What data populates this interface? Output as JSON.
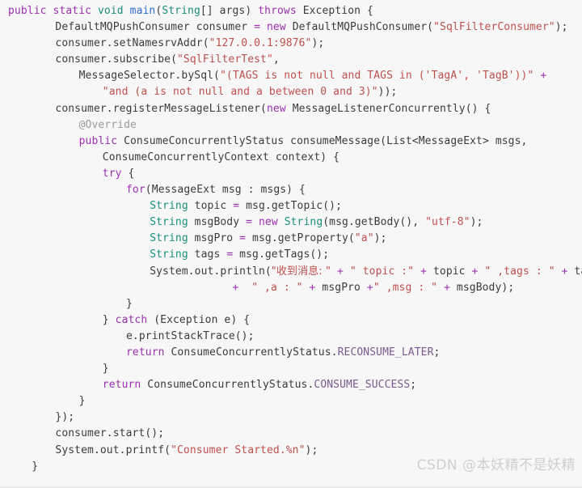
{
  "editor": {
    "background_color": "#f7f7f7",
    "language": "java",
    "font_size_px": 13,
    "line_height_px": 20,
    "colors": {
      "keyword": "#9b30b0",
      "type": "#1a8f7a",
      "function": "#2d6fd8",
      "string": "#c0504d",
      "plain": "#3b3b3b",
      "annotation": "#9a9a9a",
      "constant": "#7a5a8f"
    }
  },
  "watermark": {
    "text": "CSDN @本妖精不是妖精"
  },
  "code": {
    "lines": [
      {
        "indent": 0,
        "tokens": [
          {
            "t": "public",
            "c": "kw"
          },
          {
            "t": " ",
            "c": "plain"
          },
          {
            "t": "static",
            "c": "kw"
          },
          {
            "t": " ",
            "c": "plain"
          },
          {
            "t": "void",
            "c": "type"
          },
          {
            "t": " ",
            "c": "plain"
          },
          {
            "t": "main",
            "c": "fn"
          },
          {
            "t": "(",
            "c": "plain"
          },
          {
            "t": "String",
            "c": "type"
          },
          {
            "t": "[] args) ",
            "c": "plain"
          },
          {
            "t": "throws",
            "c": "kw"
          },
          {
            "t": " Exception {",
            "c": "plain"
          }
        ]
      },
      {
        "indent": 4,
        "tokens": [
          {
            "t": "DefaultMQPushConsumer consumer ",
            "c": "plain"
          },
          {
            "t": "=",
            "c": "op"
          },
          {
            "t": " ",
            "c": "plain"
          },
          {
            "t": "new",
            "c": "kw"
          },
          {
            "t": " DefaultMQPushConsumer(",
            "c": "plain"
          },
          {
            "t": "\"SqlFilterConsumer\"",
            "c": "str"
          },
          {
            "t": ");",
            "c": "plain"
          }
        ]
      },
      {
        "indent": 4,
        "tokens": [
          {
            "t": "consumer.setNamesrvAddr(",
            "c": "plain"
          },
          {
            "t": "\"127.0.0.1:9876\"",
            "c": "str"
          },
          {
            "t": ");",
            "c": "plain"
          }
        ]
      },
      {
        "indent": 4,
        "tokens": [
          {
            "t": "consumer.subscribe(",
            "c": "plain"
          },
          {
            "t": "\"SqlFilterTest\"",
            "c": "str"
          },
          {
            "t": ",",
            "c": "plain"
          }
        ]
      },
      {
        "indent": 6,
        "tokens": [
          {
            "t": "MessageSelector.bySql(",
            "c": "plain"
          },
          {
            "t": "\"(TAGS is not null and TAGS in ('TagA', 'TagB'))\"",
            "c": "str"
          },
          {
            "t": " ",
            "c": "plain"
          },
          {
            "t": "+",
            "c": "op"
          }
        ]
      },
      {
        "indent": 8,
        "tokens": [
          {
            "t": "\"and (a is not null and a between 0 and 3)\"",
            "c": "str"
          },
          {
            "t": "));",
            "c": "plain"
          }
        ]
      },
      {
        "indent": 4,
        "tokens": [
          {
            "t": "consumer.registerMessageListener(",
            "c": "plain"
          },
          {
            "t": "new",
            "c": "kw"
          },
          {
            "t": " MessageListenerConcurrently() {",
            "c": "plain"
          }
        ]
      },
      {
        "indent": 6,
        "tokens": [
          {
            "t": "@Override",
            "c": "anno"
          }
        ]
      },
      {
        "indent": 6,
        "tokens": [
          {
            "t": "public",
            "c": "kw"
          },
          {
            "t": " ConsumeConcurrentlyStatus consumeMessage(List<MessageExt> msgs,",
            "c": "plain"
          }
        ]
      },
      {
        "indent": 8,
        "tokens": [
          {
            "t": "ConsumeConcurrentlyContext context) {",
            "c": "plain"
          }
        ]
      },
      {
        "indent": 8,
        "tokens": [
          {
            "t": "try",
            "c": "kw"
          },
          {
            "t": " {",
            "c": "plain"
          }
        ]
      },
      {
        "indent": 10,
        "tokens": [
          {
            "t": "for",
            "c": "kw"
          },
          {
            "t": "(MessageExt msg : msgs) {",
            "c": "plain"
          }
        ]
      },
      {
        "indent": 12,
        "tokens": [
          {
            "t": "String",
            "c": "type"
          },
          {
            "t": " topic ",
            "c": "plain"
          },
          {
            "t": "=",
            "c": "op"
          },
          {
            "t": " msg.getTopic();",
            "c": "plain"
          }
        ]
      },
      {
        "indent": 12,
        "tokens": [
          {
            "t": "String",
            "c": "type"
          },
          {
            "t": " msgBody ",
            "c": "plain"
          },
          {
            "t": "=",
            "c": "op"
          },
          {
            "t": " ",
            "c": "plain"
          },
          {
            "t": "new",
            "c": "kw"
          },
          {
            "t": " ",
            "c": "plain"
          },
          {
            "t": "String",
            "c": "type"
          },
          {
            "t": "(msg.getBody(), ",
            "c": "plain"
          },
          {
            "t": "\"utf-8\"",
            "c": "str"
          },
          {
            "t": ");",
            "c": "plain"
          }
        ]
      },
      {
        "indent": 12,
        "tokens": [
          {
            "t": "String",
            "c": "type"
          },
          {
            "t": " msgPro ",
            "c": "plain"
          },
          {
            "t": "=",
            "c": "op"
          },
          {
            "t": " msg.getProperty(",
            "c": "plain"
          },
          {
            "t": "\"a\"",
            "c": "str"
          },
          {
            "t": ");",
            "c": "plain"
          }
        ]
      },
      {
        "indent": 12,
        "tokens": [
          {
            "t": "String",
            "c": "type"
          },
          {
            "t": " tags ",
            "c": "plain"
          },
          {
            "t": "=",
            "c": "op"
          },
          {
            "t": " msg.getTags();",
            "c": "plain"
          }
        ]
      },
      {
        "indent": 12,
        "tokens": [
          {
            "t": "System.out.println(",
            "c": "plain"
          },
          {
            "t": "\"收到消息: \"",
            "c": "str cjk"
          },
          {
            "t": " ",
            "c": "plain"
          },
          {
            "t": "+",
            "c": "op"
          },
          {
            "t": " ",
            "c": "plain"
          },
          {
            "t": "\" topic :\"",
            "c": "str"
          },
          {
            "t": " ",
            "c": "plain"
          },
          {
            "t": "+",
            "c": "op"
          },
          {
            "t": " topic ",
            "c": "plain"
          },
          {
            "t": "+",
            "c": "op"
          },
          {
            "t": " ",
            "c": "plain"
          },
          {
            "t": "\" ,tags : \"",
            "c": "str"
          },
          {
            "t": " ",
            "c": "plain"
          },
          {
            "t": "+",
            "c": "op"
          },
          {
            "t": " tags",
            "c": "plain"
          }
        ]
      },
      {
        "indent": 19,
        "tokens": [
          {
            "t": "+",
            "c": "op"
          },
          {
            "t": "  ",
            "c": "plain"
          },
          {
            "t": "\" ,a : \"",
            "c": "str"
          },
          {
            "t": " ",
            "c": "plain"
          },
          {
            "t": "+",
            "c": "op"
          },
          {
            "t": " msgPro ",
            "c": "plain"
          },
          {
            "t": "+",
            "c": "op"
          },
          {
            "t": "\" ,msg : \"",
            "c": "str"
          },
          {
            "t": " ",
            "c": "plain"
          },
          {
            "t": "+",
            "c": "op"
          },
          {
            "t": " msgBody);",
            "c": "plain"
          }
        ]
      },
      {
        "indent": 10,
        "tokens": [
          {
            "t": "}",
            "c": "plain"
          }
        ]
      },
      {
        "indent": 8,
        "tokens": [
          {
            "t": "} ",
            "c": "plain"
          },
          {
            "t": "catch",
            "c": "kw"
          },
          {
            "t": " (Exception e) {",
            "c": "plain"
          }
        ]
      },
      {
        "indent": 10,
        "tokens": [
          {
            "t": "e.printStackTrace();",
            "c": "plain"
          }
        ]
      },
      {
        "indent": 10,
        "tokens": [
          {
            "t": "return",
            "c": "kw"
          },
          {
            "t": " ConsumeConcurrentlyStatus.",
            "c": "plain"
          },
          {
            "t": "RECONSUME_LATER",
            "c": "const"
          },
          {
            "t": ";",
            "c": "plain"
          }
        ]
      },
      {
        "indent": 8,
        "tokens": [
          {
            "t": "}",
            "c": "plain"
          }
        ]
      },
      {
        "indent": 8,
        "tokens": [
          {
            "t": "return",
            "c": "kw"
          },
          {
            "t": " ConsumeConcurrentlyStatus.",
            "c": "plain"
          },
          {
            "t": "CONSUME_SUCCESS",
            "c": "const"
          },
          {
            "t": ";",
            "c": "plain"
          }
        ]
      },
      {
        "indent": 6,
        "tokens": [
          {
            "t": "}",
            "c": "plain"
          }
        ]
      },
      {
        "indent": 4,
        "tokens": [
          {
            "t": "});",
            "c": "plain"
          }
        ]
      },
      {
        "indent": 4,
        "tokens": [
          {
            "t": "consumer.start();",
            "c": "plain"
          }
        ]
      },
      {
        "indent": 4,
        "tokens": [
          {
            "t": "System.out.printf(",
            "c": "plain"
          },
          {
            "t": "\"Consumer Started.%n\"",
            "c": "str"
          },
          {
            "t": ");",
            "c": "plain"
          }
        ]
      },
      {
        "indent": 2,
        "tokens": [
          {
            "t": "}",
            "c": "plain"
          }
        ]
      }
    ]
  }
}
